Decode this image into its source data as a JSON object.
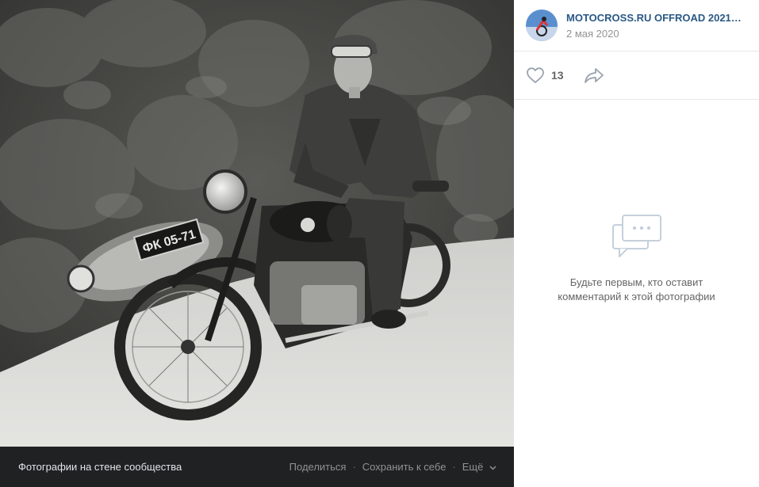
{
  "photo": {
    "alt_description_hidden": "",
    "footer": {
      "album_label": "Фотографии на стене сообщества",
      "share_label": "Поделиться",
      "save_label": "Сохранить к себе",
      "more_label": "Ещё",
      "separator": "·"
    },
    "plate_text": "ФК 05-71"
  },
  "sidebar": {
    "author_name": "MOTOCROSS.RU OFFROAD 2021 мо...",
    "post_date": "2 мая 2020",
    "likes_count": "13",
    "empty_comments": {
      "line1": "Будьте первым, кто оставит",
      "line2": "комментарий к этой фотографии"
    }
  },
  "colors": {
    "link_blue": "#2a5885",
    "footer_bg": "#202123",
    "icon_blue": "#99a2ad"
  }
}
